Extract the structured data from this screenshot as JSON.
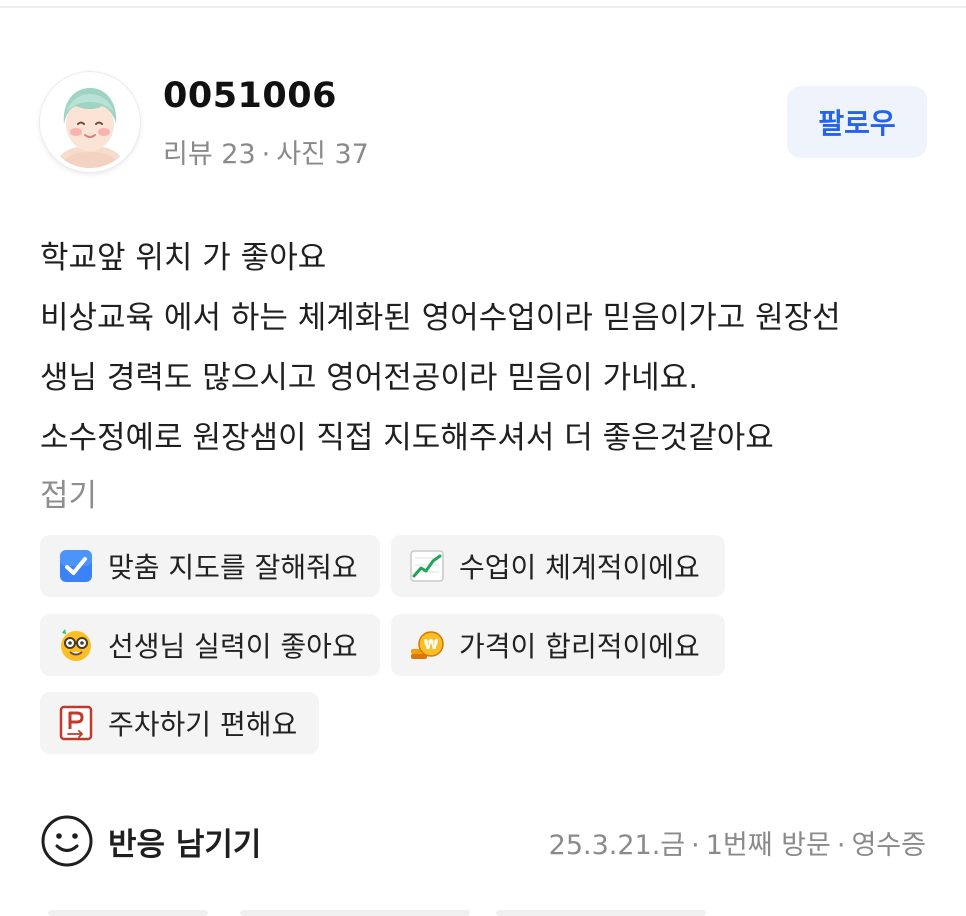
{
  "reviewer": {
    "name": "0051006",
    "reviews_label": "리뷰 23",
    "photos_label": "사진 37",
    "separator": "·"
  },
  "follow_button": {
    "label": "팔로우"
  },
  "review": {
    "lines": [
      "학교앞 위치 가 좋아요",
      "비상교육 에서 하는 체계화된 영어수업이라 믿음이가고 원장선",
      "생님 경력도 많으시고 영어전공이라 믿음이 가네요.",
      "소수정예로 원장샘이 직접 지도해주셔서 더 좋은것같아요"
    ],
    "collapse_label": "접기"
  },
  "tags": [
    {
      "icon": "check-box-icon",
      "label": "맞춤 지도를 잘해줘요"
    },
    {
      "icon": "chart-up-icon",
      "label": "수업이 체계적이에요"
    },
    {
      "icon": "nerd-face-icon",
      "label": "선생님 실력이 좋아요"
    },
    {
      "icon": "coins-icon",
      "label": "가격이 합리적이에요"
    },
    {
      "icon": "parking-icon",
      "label": "주차하기 편해요"
    }
  ],
  "reaction": {
    "label": "반응 남기기",
    "icon": "smile-icon"
  },
  "visit_meta": {
    "date": "25.3.21.금",
    "visit": "1번째 방문",
    "verification": "영수증",
    "separator": "·"
  },
  "colors": {
    "accent": "#2563eb",
    "follow_bg": "#eef3fc",
    "tag_bg": "#f4f4f5",
    "muted_text": "#8a8a8a"
  }
}
